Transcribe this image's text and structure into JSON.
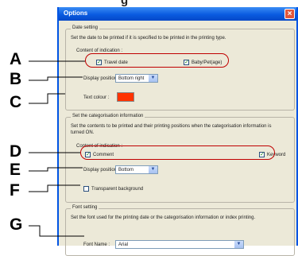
{
  "heading_fragment": "g",
  "window": {
    "title": "Options",
    "close_glyph": "×"
  },
  "date_setting": {
    "legend": "Date setting",
    "description": "Set the date to be printed if it is specified to be printed in the printing type.",
    "content_label": "Content of indication :",
    "travel_date": {
      "label": "Travel date",
      "checked": true
    },
    "baby_pet": {
      "label": "Baby/Pet(age)",
      "checked": true
    },
    "display_position_label": "Display position :",
    "display_position_value": "Bottom right",
    "text_colour_label": "Text colour :",
    "text_colour": "#ff3300"
  },
  "categorisation": {
    "legend": "Set the categorisation information",
    "description": "Set the contents to be printed and their printing positions when the categorisation information is turned ON.",
    "content_label": "Content of indication :",
    "comment": {
      "label": "Comment",
      "checked": true
    },
    "keyword": {
      "label": "Keyword",
      "checked": true
    },
    "display_position_label": "Display position :",
    "display_position_value": "Bottom",
    "transparent": {
      "label": "Transparent background",
      "checked": false
    }
  },
  "font_setting": {
    "legend": "Font setting",
    "description": "Set the font used for the printing date or the categorisation information or index printing.",
    "font_name_label": "Font Name :",
    "font_name_value": "Arial"
  },
  "callouts": [
    "A",
    "B",
    "C",
    "D",
    "E",
    "F",
    "G"
  ],
  "check_glyph": "✓",
  "dropdown_glyph": "▼"
}
